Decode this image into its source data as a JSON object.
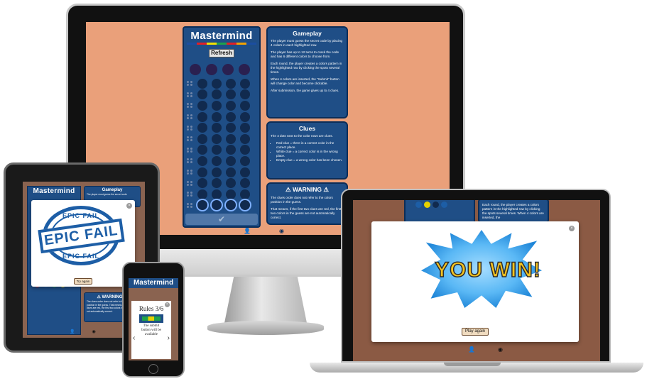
{
  "desktop": {
    "title": "Mastermind",
    "refresh_label": "Refresh",
    "submit_icon": "✔",
    "strip_colors": [
      "#1b4ea0",
      "#e21f26",
      "#f3e200",
      "#1fa24a",
      "#e21f26",
      "#f3a300",
      "#1b4ea0"
    ],
    "gameplay": {
      "heading": "Gameplay",
      "paragraphs": [
        "The player must guess the secret code by placing 4 colors in each highlighted row.",
        "The player has up to 12 turns to crack the code and has 6 different colors to choose from.",
        "Each round, the player creates a colors pattern in the highlighted row by clicking the spots several times.",
        "When 4 colors are inserted, the \"Submit\" button will change color and become clickable.",
        "After submission, the game gives up to 4 clues."
      ]
    },
    "clues": {
      "heading": "Clues",
      "intro": "The 4 dots next to the color rows are clues.",
      "items": [
        "Red clue = there is a correct color in the correct place.",
        "White clue = a correct color is in the wrong place.",
        "Empty clue = a wrong color has been chosen."
      ]
    },
    "warning": {
      "heading": "⚠ WARNING ⚠",
      "paragraphs": [
        "The clues order does not refer to the colors position in the guess.",
        "That means, if the first two clues are red, the first two colors in the guess are not automatically correct."
      ]
    },
    "footer_icons": [
      "user-icon",
      "github-icon"
    ],
    "footer_glyphs": [
      "👤",
      "◉"
    ]
  },
  "tablet": {
    "title": "Mastermind",
    "gameplay_heading": "Gameplay",
    "gameplay_text": "The player must guess the secret code",
    "warning_heading": "⚠ WARNING ⚠",
    "warning_text": "The clues order does not refer to the colors position in the guess. That means, if the first two clues are red, the first two colors in the guess are not automatically correct.",
    "modal": {
      "stamp_main": "EPIC FAIL",
      "stamp_top": "EPIC FAIL",
      "stamp_bottom": "EPIC FAIL",
      "button": "Try again",
      "close": "×"
    },
    "footer_glyphs": [
      "👤",
      "◉"
    ]
  },
  "phone": {
    "title": "Mastermind",
    "modal": {
      "heading": "Rules 3/6",
      "text": "The submit button will be available",
      "prev": "‹",
      "next": "›",
      "close": "×"
    }
  },
  "laptop": {
    "panel_text": "Each round, the player creates a colors pattern in the highlighted row by clicking the spots several times. When 4 colors are inserted, the",
    "modal": {
      "win_text": "YOU WIN!",
      "button": "Play again",
      "close": "×"
    },
    "footer_glyphs": [
      "👤",
      "◉"
    ]
  }
}
